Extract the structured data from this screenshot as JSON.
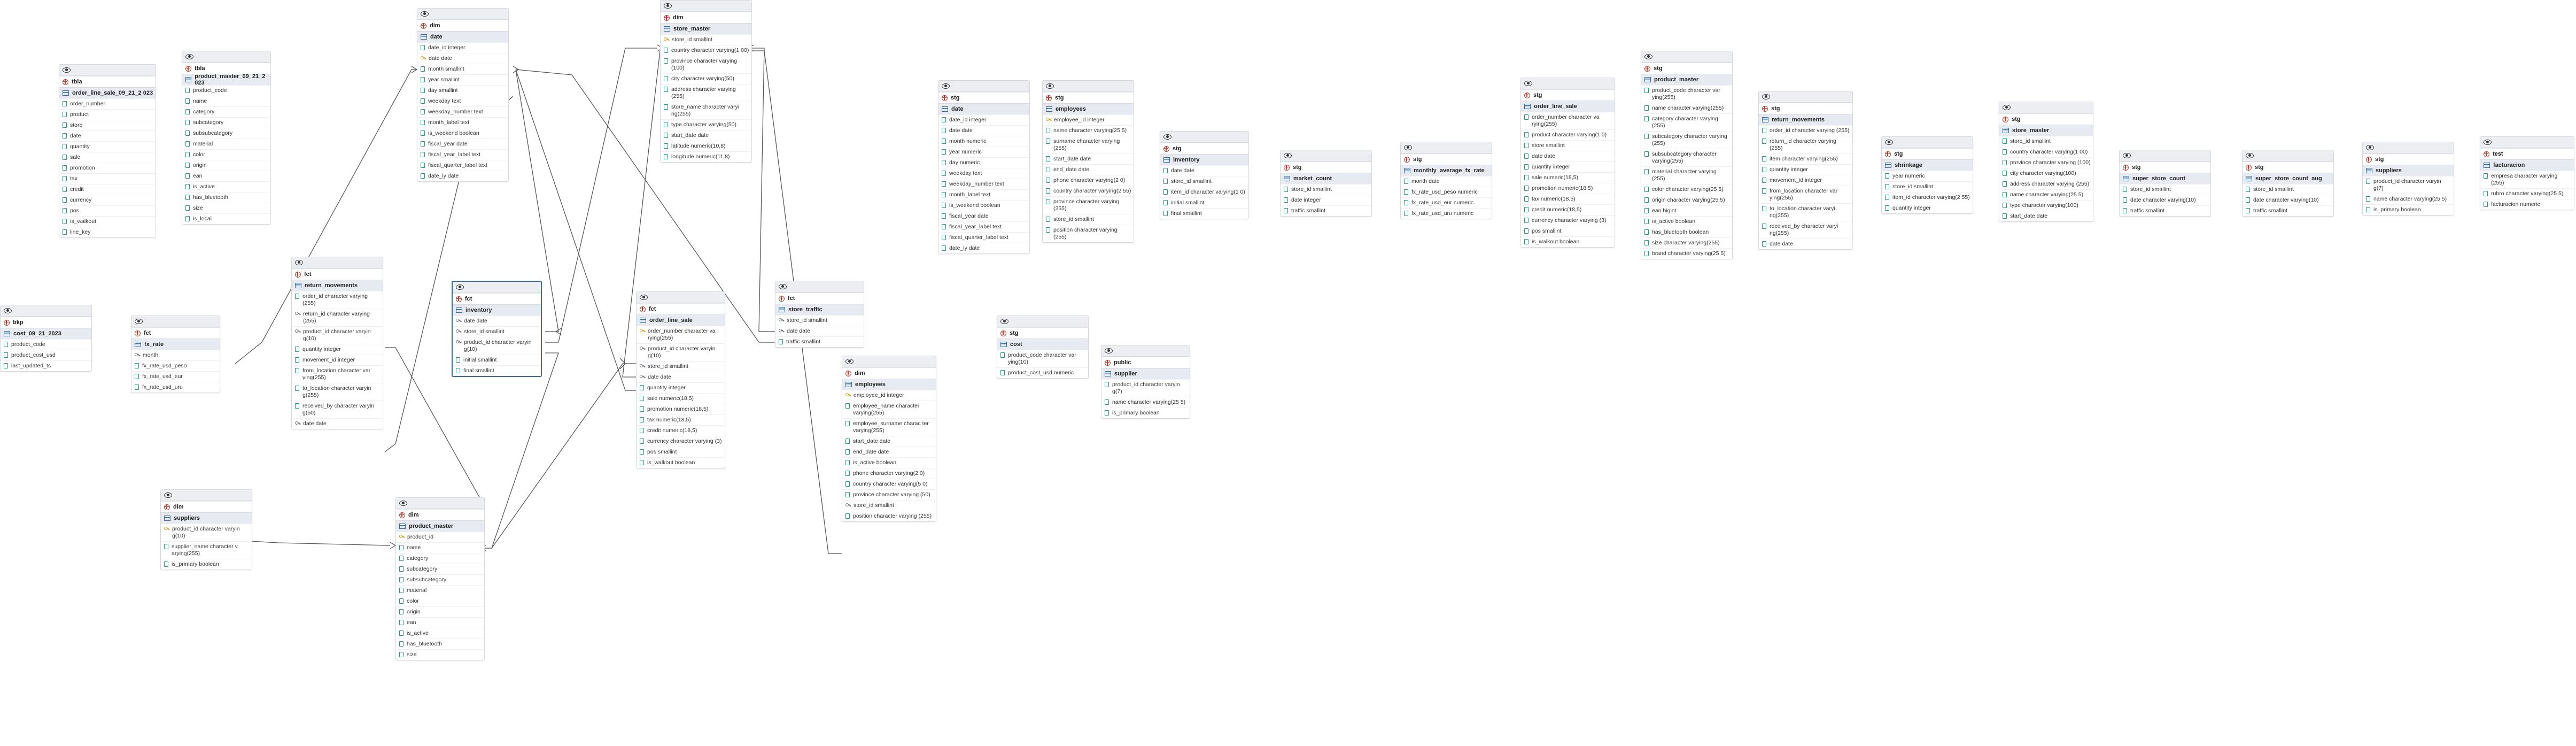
{
  "tables": [
    {
      "id": "t1",
      "schema": "tbla",
      "name": "order_line_sale_09_21_2 023",
      "cols": [
        [
          "c",
          "order_number"
        ],
        [
          "c",
          "product"
        ],
        [
          "c",
          "store"
        ],
        [
          "c",
          "date"
        ],
        [
          "c",
          "quantity"
        ],
        [
          "c",
          "sale"
        ],
        [
          "c",
          "promotion"
        ],
        [
          "c",
          "tax"
        ],
        [
          "c",
          "credit"
        ],
        [
          "c",
          "currency"
        ],
        [
          "c",
          "pos"
        ],
        [
          "c",
          "is_walkout"
        ],
        [
          "c",
          "line_key"
        ]
      ]
    },
    {
      "id": "t2",
      "schema": "tbla",
      "name": "product_master_09_21_2 023",
      "cols": [
        [
          "c",
          "product_code"
        ],
        [
          "c",
          "name"
        ],
        [
          "c",
          "category"
        ],
        [
          "c",
          "subcategory"
        ],
        [
          "c",
          "subsubcategory"
        ],
        [
          "c",
          "material"
        ],
        [
          "c",
          "color"
        ],
        [
          "c",
          "origin"
        ],
        [
          "c",
          "ean"
        ],
        [
          "c",
          "is_active"
        ],
        [
          "c",
          "has_bluetooth"
        ],
        [
          "c",
          "size"
        ],
        [
          "c",
          "is_local"
        ]
      ]
    },
    {
      "id": "t3",
      "schema": "bkp",
      "name": "cost_09_21_2023",
      "cols": [
        [
          "c",
          "product_code"
        ],
        [
          "c",
          "product_cost_usd"
        ],
        [
          "c",
          "last_updated_ts"
        ]
      ]
    },
    {
      "id": "t4",
      "schema": "fct",
      "name": "fx_rate",
      "cols": [
        [
          "f",
          "month"
        ],
        [
          "c",
          "fx_rate_usd_peso"
        ],
        [
          "c",
          "fx_rate_usd_eur"
        ],
        [
          "c",
          "fx_rate_usd_uru"
        ]
      ]
    },
    {
      "id": "t5",
      "schema": "dim",
      "name": "date",
      "cols": [
        [
          "c",
          "date_id integer"
        ],
        [
          "k",
          "date date"
        ],
        [
          "c",
          "month smallint"
        ],
        [
          "c",
          "year smallint"
        ],
        [
          "c",
          "day smallint"
        ],
        [
          "c",
          "weekday text"
        ],
        [
          "c",
          "weekday_number text"
        ],
        [
          "c",
          "month_label text"
        ],
        [
          "c",
          "is_weekend boolean"
        ],
        [
          "c",
          "fiscal_year date"
        ],
        [
          "c",
          "fiscal_year_label text"
        ],
        [
          "c",
          "fiscal_quarter_label text"
        ],
        [
          "c",
          "date_ly date"
        ]
      ]
    },
    {
      "id": "t6",
      "schema": "dim",
      "name": "store_master",
      "cols": [
        [
          "k",
          "store_id smallint"
        ],
        [
          "c",
          "country character varying(1 00)"
        ],
        [
          "c",
          "province character varying (100)"
        ],
        [
          "c",
          "city character varying(50)"
        ],
        [
          "c",
          "address character varying (255)"
        ],
        [
          "c",
          "store_name character varyi ng(255)"
        ],
        [
          "c",
          "type character varying(50)"
        ],
        [
          "c",
          "start_date date"
        ],
        [
          "c",
          "latitude numeric(10,8)"
        ],
        [
          "c",
          "longitude numeric(11,8)"
        ]
      ]
    },
    {
      "id": "t7",
      "schema": "fct",
      "name": "return_movements",
      "cols": [
        [
          "c",
          "order_id character varying (255)"
        ],
        [
          "f",
          "return_id character varying (255)"
        ],
        [
          "f",
          "product_id character varyin g(10)"
        ],
        [
          "c",
          "quantity integer"
        ],
        [
          "c",
          "movement_id integer"
        ],
        [
          "c",
          "from_location character var ying(255)"
        ],
        [
          "c",
          "to_location character varyin g(255)"
        ],
        [
          "c",
          "received_by character varyin g(50)"
        ],
        [
          "f",
          "date date"
        ]
      ]
    },
    {
      "id": "t8",
      "schema": "fct",
      "name": "inventory",
      "cols": [
        [
          "f",
          "date date"
        ],
        [
          "f",
          "store_id smallint"
        ],
        [
          "f",
          "product_id character varyin g(10)"
        ],
        [
          "c",
          "initial smallint"
        ],
        [
          "c",
          "final smallint"
        ]
      ]
    },
    {
      "id": "t9",
      "schema": "fct",
      "name": "order_line_sale",
      "cols": [
        [
          "k",
          "order_number character va rying(255)"
        ],
        [
          "f",
          "product_id character varyin g(10)"
        ],
        [
          "f",
          "store_id smallint"
        ],
        [
          "f",
          "date date"
        ],
        [
          "c",
          "quantity integer"
        ],
        [
          "c",
          "sale numeric(18,5)"
        ],
        [
          "c",
          "promotion numeric(18,5)"
        ],
        [
          "c",
          "tax numeric(18,5)"
        ],
        [
          "c",
          "credit numeric(18,5)"
        ],
        [
          "c",
          "currency character varying (3)"
        ],
        [
          "c",
          "pos smallint"
        ],
        [
          "c",
          "is_walkout boolean"
        ]
      ]
    },
    {
      "id": "t10",
      "schema": "fct",
      "name": "store_traffic",
      "cols": [
        [
          "f",
          "store_id smallint"
        ],
        [
          "f",
          "date date"
        ],
        [
          "c",
          "traffic smallint"
        ]
      ]
    },
    {
      "id": "t11",
      "schema": "dim",
      "name": "employees",
      "cols": [
        [
          "k",
          "employee_id integer"
        ],
        [
          "c",
          "employee_name character varying(255)"
        ],
        [
          "c",
          "employee_surname charac ter varying(255)"
        ],
        [
          "c",
          "start_date date"
        ],
        [
          "c",
          "end_date date"
        ],
        [
          "c",
          "is_active boolean"
        ],
        [
          "c",
          "phone character varying(2 0)"
        ],
        [
          "c",
          "country character varying(5 0)"
        ],
        [
          "c",
          "province character varying (50)"
        ],
        [
          "f",
          "store_id smallint"
        ],
        [
          "c",
          "position character varying (255)"
        ]
      ]
    },
    {
      "id": "t12",
      "schema": "dim",
      "name": "suppliers",
      "cols": [
        [
          "k",
          "product_id character varyin g(10)"
        ],
        [
          "c",
          "supplier_name character v arying(255)"
        ],
        [
          "c",
          "is_primary boolean"
        ]
      ]
    },
    {
      "id": "t13",
      "schema": "dim",
      "name": "product_master",
      "cols": [
        [
          "k",
          "product_id"
        ],
        [
          "c",
          "name"
        ],
        [
          "c",
          "category"
        ],
        [
          "c",
          "subcategory"
        ],
        [
          "c",
          "subsubcategory"
        ],
        [
          "c",
          "material"
        ],
        [
          "c",
          "color"
        ],
        [
          "c",
          "origin"
        ],
        [
          "c",
          "ean"
        ],
        [
          "c",
          "is_active"
        ],
        [
          "c",
          "has_bluetooth"
        ],
        [
          "c",
          "size"
        ]
      ]
    },
    {
      "id": "t14",
      "schema": "stg",
      "name": "date",
      "cols": [
        [
          "c",
          "date_id integer"
        ],
        [
          "c",
          "date date"
        ],
        [
          "c",
          "month numeric"
        ],
        [
          "c",
          "year numeric"
        ],
        [
          "c",
          "day numeric"
        ],
        [
          "c",
          "weekday text"
        ],
        [
          "c",
          "weekday_number text"
        ],
        [
          "c",
          "month_label text"
        ],
        [
          "c",
          "is_weekend boolean"
        ],
        [
          "c",
          "fiscal_year date"
        ],
        [
          "c",
          "fiscal_year_label text"
        ],
        [
          "c",
          "fiscal_quarter_label text"
        ],
        [
          "c",
          "date_ly date"
        ]
      ]
    },
    {
      "id": "t15",
      "schema": "stg",
      "name": "employees",
      "cols": [
        [
          "k",
          "employee_id integer"
        ],
        [
          "c",
          "name character varying(25 5)"
        ],
        [
          "c",
          "surname character varying (255)"
        ],
        [
          "c",
          "start_date date"
        ],
        [
          "c",
          "end_date date"
        ],
        [
          "c",
          "phone character varying(2 0)"
        ],
        [
          "c",
          "country character varying(2 55)"
        ],
        [
          "c",
          "province character varying (255)"
        ],
        [
          "c",
          "store_id smallint"
        ],
        [
          "c",
          "position character varying (255)"
        ]
      ]
    },
    {
      "id": "t16",
      "schema": "stg",
      "name": "cost",
      "cols": [
        [
          "c",
          "product_code character var ying(10)"
        ],
        [
          "c",
          "product_cost_usd numeric"
        ]
      ]
    },
    {
      "id": "t17",
      "schema": "stg",
      "name": "inventory",
      "cols": [
        [
          "c",
          "date date"
        ],
        [
          "c",
          "store_id smallint"
        ],
        [
          "c",
          "item_id character varying(1 0)"
        ],
        [
          "c",
          "initial smallint"
        ],
        [
          "c",
          "final smallint"
        ]
      ]
    },
    {
      "id": "t18",
      "schema": "public",
      "name": "supplier",
      "cols": [
        [
          "c",
          "product_id character varyin g(7)"
        ],
        [
          "c",
          "name character varying(25 5)"
        ],
        [
          "c",
          "is_primary boolean"
        ]
      ]
    },
    {
      "id": "t19",
      "schema": "stg",
      "name": "market_count",
      "cols": [
        [
          "c",
          "store_id smallint"
        ],
        [
          "c",
          "date integer"
        ],
        [
          "c",
          "traffic smallint"
        ]
      ]
    },
    {
      "id": "t20",
      "schema": "stg",
      "name": "monthly_average_fx_rate",
      "cols": [
        [
          "c",
          "month date"
        ],
        [
          "c",
          "fx_rate_usd_peso numeric"
        ],
        [
          "c",
          "fx_rate_usd_eur numeric"
        ],
        [
          "c",
          "fx_rate_usd_uru numeric"
        ]
      ]
    },
    {
      "id": "t21",
      "schema": "stg",
      "name": "order_line_sale",
      "cols": [
        [
          "c",
          "order_number character va rying(255)"
        ],
        [
          "c",
          "product character varying(1 0)"
        ],
        [
          "c",
          "store smallint"
        ],
        [
          "c",
          "date date"
        ],
        [
          "c",
          "quantity integer"
        ],
        [
          "c",
          "sale numeric(18,5)"
        ],
        [
          "c",
          "promotion numeric(18,5)"
        ],
        [
          "c",
          "tax numeric(18,5)"
        ],
        [
          "c",
          "credit numeric(18,5)"
        ],
        [
          "c",
          "currency character varying (3)"
        ],
        [
          "c",
          "pos smallint"
        ],
        [
          "c",
          "is_walkout boolean"
        ]
      ]
    },
    {
      "id": "t22",
      "schema": "stg",
      "name": "product_master",
      "cols": [
        [
          "c",
          "product_code character var ying(255)"
        ],
        [
          "c",
          "name character varying(255)"
        ],
        [
          "c",
          "category character varying (255)"
        ],
        [
          "c",
          "subcategory character varying (255)"
        ],
        [
          "c",
          "subsubcategory character varying(255)"
        ],
        [
          "c",
          "material character varying (255)"
        ],
        [
          "c",
          "color character varying(25 5)"
        ],
        [
          "c",
          "origin character varying(25 5)"
        ],
        [
          "c",
          "ean bigint"
        ],
        [
          "c",
          "is_active boolean"
        ],
        [
          "c",
          "has_bluetooth boolean"
        ],
        [
          "c",
          "size character varying(255)"
        ],
        [
          "c",
          "brand character varying(25 5)"
        ]
      ]
    },
    {
      "id": "t23",
      "schema": "stg",
      "name": "return_movements",
      "cols": [
        [
          "c",
          "order_id character varying (255)"
        ],
        [
          "c",
          "return_id character varying (255)"
        ],
        [
          "c",
          "item character varying(255)"
        ],
        [
          "c",
          "quantity integer"
        ],
        [
          "c",
          "movement_id integer"
        ],
        [
          "c",
          "from_location character var ying(255)"
        ],
        [
          "c",
          "to_location character varyi ng(255)"
        ],
        [
          "c",
          "received_by character varyi ng(255)"
        ],
        [
          "c",
          "date date"
        ]
      ]
    },
    {
      "id": "t24",
      "schema": "stg",
      "name": "shrinkage",
      "cols": [
        [
          "c",
          "year numeric"
        ],
        [
          "c",
          "store_id smallint"
        ],
        [
          "c",
          "item_id character varying(2 55)"
        ],
        [
          "c",
          "quantity integer"
        ]
      ]
    },
    {
      "id": "t25",
      "schema": "stg",
      "name": "store_master",
      "cols": [
        [
          "c",
          "store_id smallint"
        ],
        [
          "c",
          "country character varying(1 00)"
        ],
        [
          "c",
          "province character varying (100)"
        ],
        [
          "c",
          "city character varying(100)"
        ],
        [
          "c",
          "address character varying (255)"
        ],
        [
          "c",
          "name character varying(25 5)"
        ],
        [
          "c",
          "type character varying(100)"
        ],
        [
          "c",
          "start_date date"
        ]
      ]
    },
    {
      "id": "t26",
      "schema": "stg",
      "name": "super_store_count",
      "cols": [
        [
          "c",
          "store_id smallint"
        ],
        [
          "c",
          "date character varying(10)"
        ],
        [
          "c",
          "traffic smallint"
        ]
      ]
    },
    {
      "id": "t27",
      "schema": "stg",
      "name": "super_store_count_aug",
      "cols": [
        [
          "c",
          "store_id smallint"
        ],
        [
          "c",
          "date character varying(10)"
        ],
        [
          "c",
          "traffic smallint"
        ]
      ]
    },
    {
      "id": "t28",
      "schema": "stg",
      "name": "suppliers",
      "cols": [
        [
          "c",
          "product_id character varyin g(7)"
        ],
        [
          "c",
          "name character varying(25 5)"
        ],
        [
          "c",
          "is_primary boolean"
        ]
      ]
    },
    {
      "id": "t29",
      "schema": "test",
      "name": "facturacion",
      "cols": [
        [
          "c",
          "empresa character varying (255)"
        ],
        [
          "c",
          "rubro character varying(25 5)"
        ],
        [
          "c",
          "facturacion numeric"
        ]
      ]
    }
  ]
}
